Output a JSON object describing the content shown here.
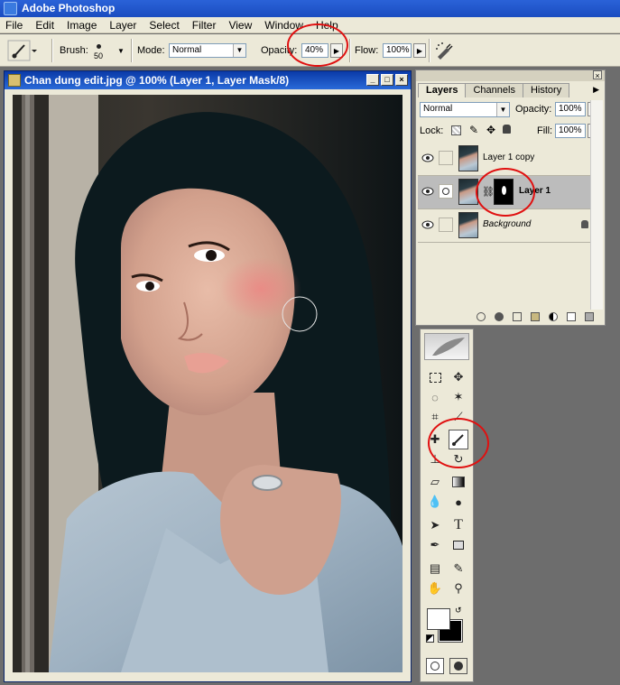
{
  "app": {
    "title": "Adobe Photoshop"
  },
  "menu": [
    "File",
    "Edit",
    "Image",
    "Layer",
    "Select",
    "Filter",
    "View",
    "Window",
    "Help"
  ],
  "options": {
    "brush_label": "Brush:",
    "brush_size": "50",
    "mode_label": "Mode:",
    "mode_value": "Normal",
    "opacity_label": "Opacity:",
    "opacity_value": "40%",
    "flow_label": "Flow:",
    "flow_value": "100%"
  },
  "document": {
    "title": "Chan dung edit.jpg @ 100% (Layer 1, Layer Mask/8)"
  },
  "layers_palette": {
    "tabs": [
      "Layers",
      "Channels",
      "History"
    ],
    "blend_mode": "Normal",
    "opacity_label": "Opacity:",
    "opacity_value": "100%",
    "lock_label": "Lock:",
    "fill_label": "Fill:",
    "fill_value": "100%",
    "layers": [
      {
        "name": "Layer 1 copy",
        "selected": false
      },
      {
        "name": "Layer 1",
        "selected": true
      },
      {
        "name": "Background",
        "selected": false
      }
    ]
  },
  "colors": {
    "highlight_ring": "#e01010",
    "title_bar": "#2a62d8"
  }
}
